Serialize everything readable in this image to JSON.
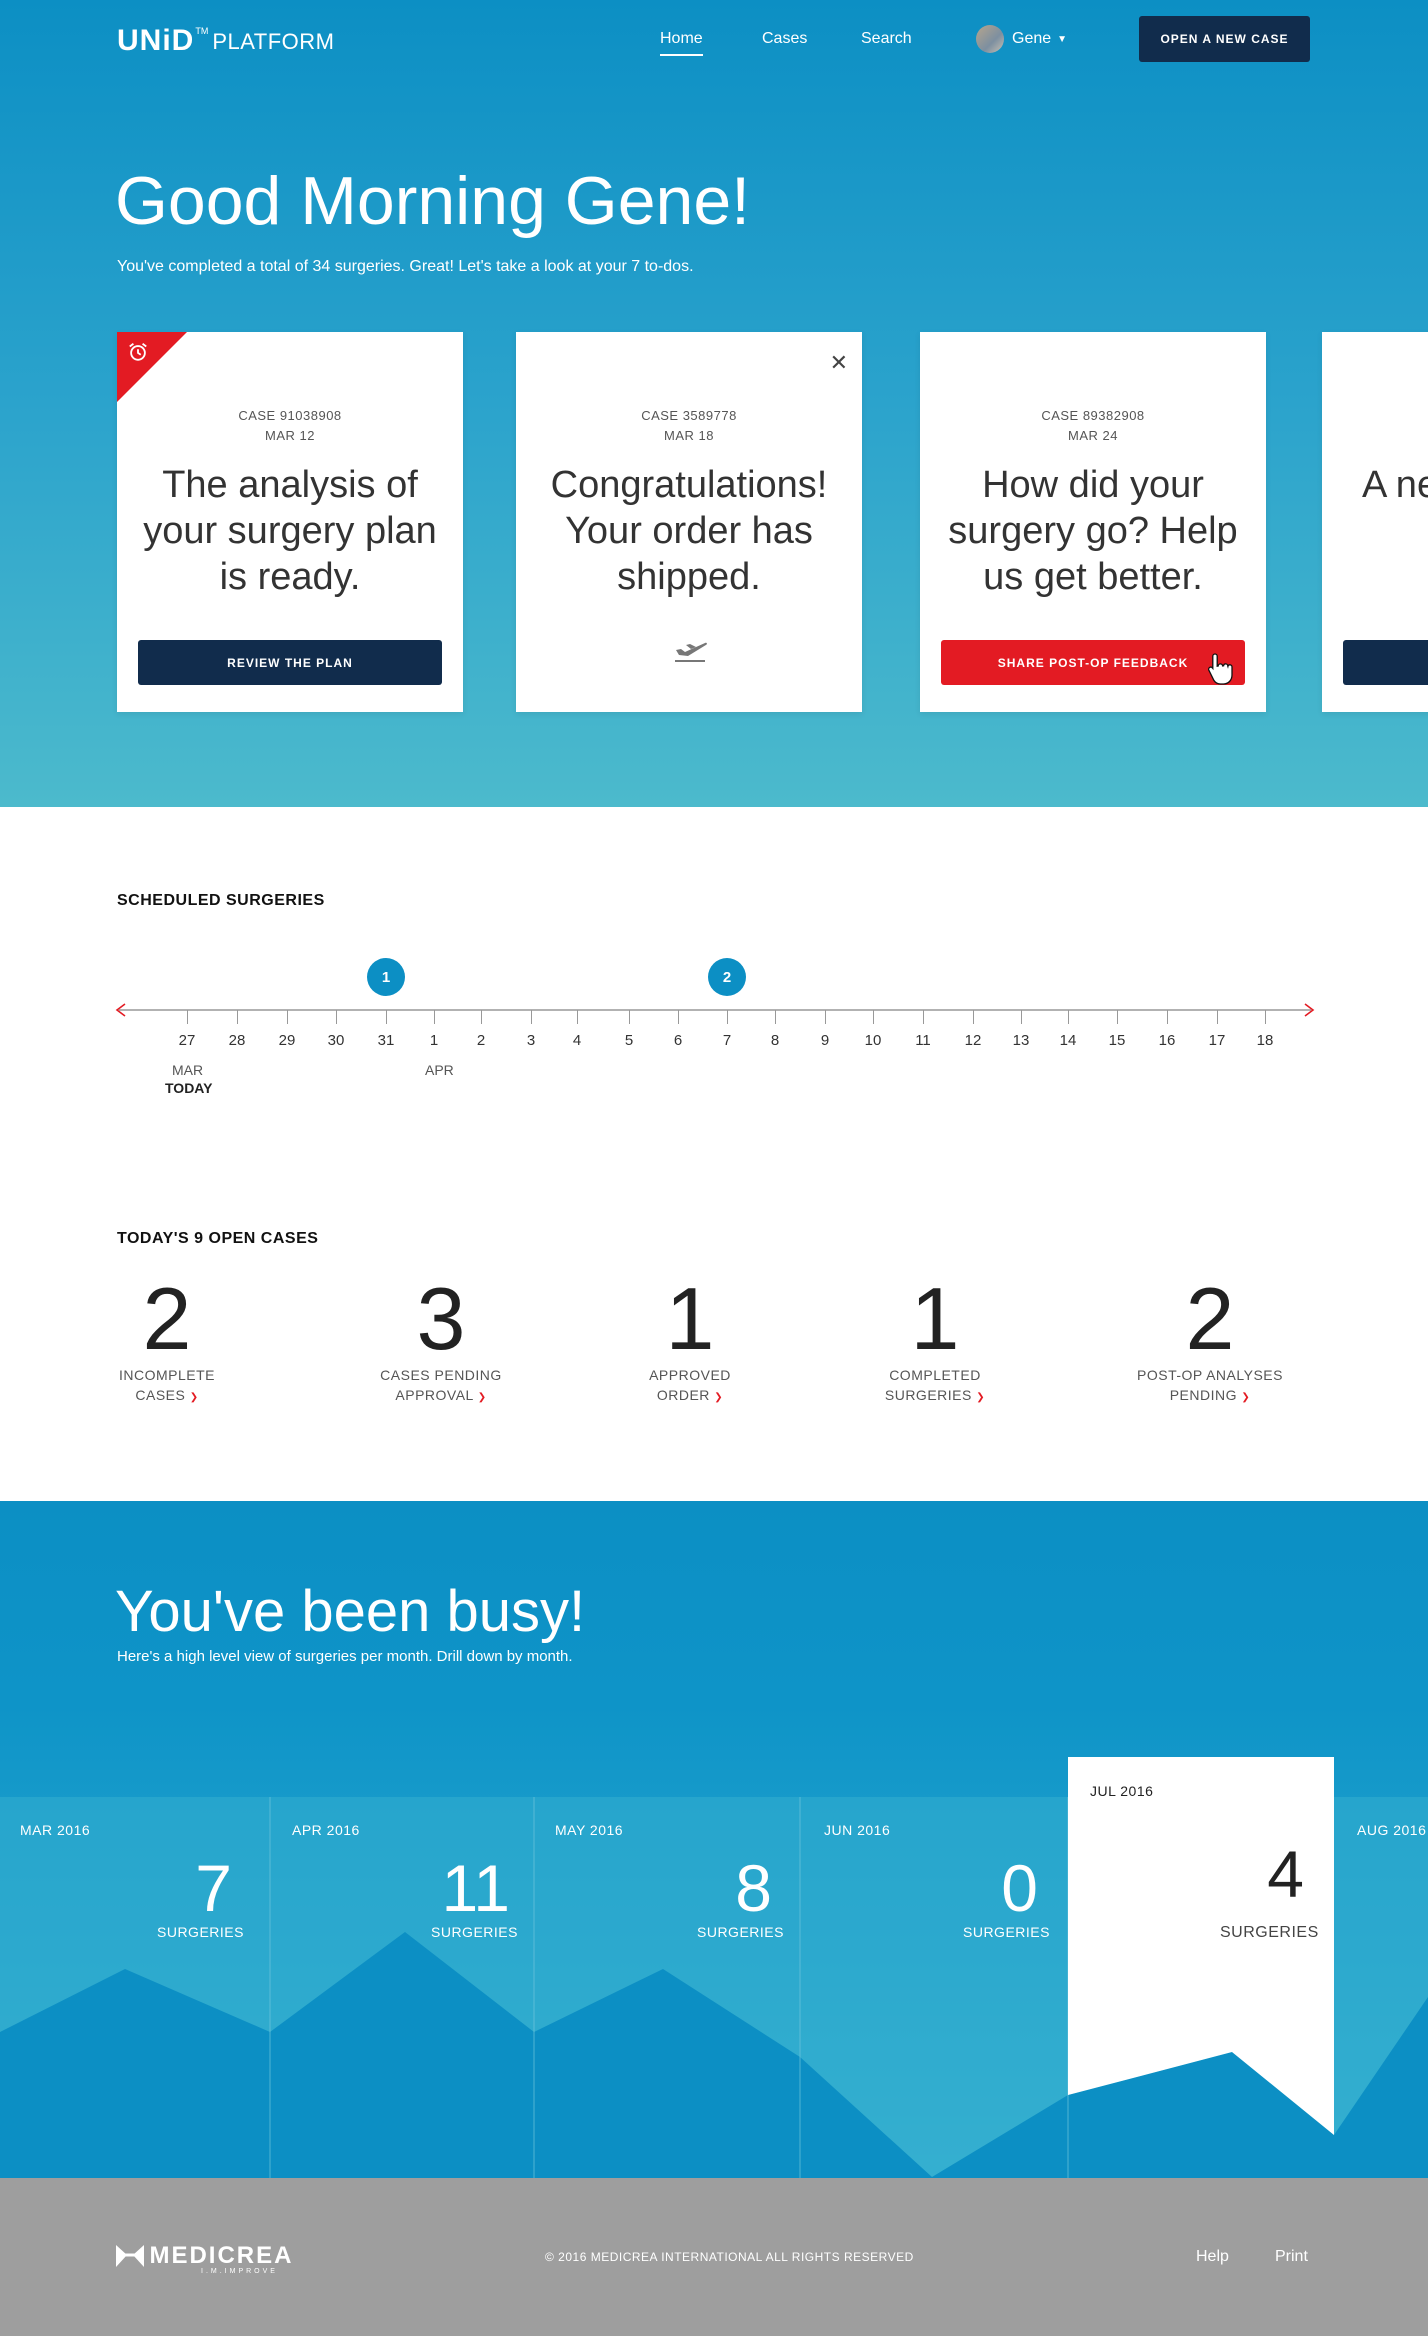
{
  "header": {
    "logo_main": "UNiD",
    "logo_tm": "TM",
    "logo_sub": "PLATFORM",
    "nav": [
      "Home",
      "Cases",
      "Search"
    ],
    "user_name": "Gene",
    "open_case": "OPEN A NEW CASE"
  },
  "hero": {
    "greeting": "Good Morning Gene!",
    "subtitle": "You've completed a total of 34 surgeries. Great! Let's take a look at your 7 to-dos."
  },
  "cards": [
    {
      "case": "CASE 91038908",
      "date": "MAR 12",
      "body": "The analysis of your surgery plan is ready.",
      "button": "REVIEW THE PLAN"
    },
    {
      "case": "CASE 3589778",
      "date": "MAR 18",
      "body": "Congratulations! Your order has shipped."
    },
    {
      "case": "CASE 89382908",
      "date": "MAR 24",
      "body": "How did your surgery go? Help us get better.",
      "button": "SHARE POST-OP FEEDBACK"
    },
    {
      "body": "A ne be v"
    }
  ],
  "scheduled": {
    "title": "SCHEDULED SURGERIES",
    "days": [
      "27",
      "28",
      "29",
      "30",
      "31",
      "1",
      "2",
      "3",
      "4",
      "5",
      "6",
      "7",
      "8",
      "9",
      "10",
      "11",
      "12",
      "13",
      "14",
      "15",
      "16",
      "17",
      "18"
    ],
    "month_labels": [
      "MAR",
      "APR"
    ],
    "today": "TODAY",
    "markers": [
      {
        "day": "31",
        "count": "1"
      },
      {
        "day": "7",
        "count": "2"
      }
    ]
  },
  "open_cases": {
    "title": "TODAY'S 9 OPEN CASES",
    "items": [
      {
        "count": "2",
        "line1": "INCOMPLETE",
        "line2": "CASES"
      },
      {
        "count": "3",
        "line1": "CASES PENDING",
        "line2": "APPROVAL"
      },
      {
        "count": "1",
        "line1": "APPROVED",
        "line2": "ORDER"
      },
      {
        "count": "1",
        "line1": "COMPLETED",
        "line2": "SURGERIES"
      },
      {
        "count": "2",
        "line1": "POST-OP ANALYSES",
        "line2": "PENDING"
      }
    ]
  },
  "busy": {
    "title": "You've been busy!",
    "subtitle": "Here's a high level view of surgeries per month. Drill down by month.",
    "unit": "SURGERIES",
    "months": [
      {
        "label": "MAR 2016",
        "count": "7"
      },
      {
        "label": "APR 2016",
        "count": "11"
      },
      {
        "label": "MAY 2016",
        "count": "8"
      },
      {
        "label": "JUN 2016",
        "count": "0"
      },
      {
        "label": "JUL 2016",
        "count": "4",
        "selected": true
      },
      {
        "label": "AUG 2016"
      }
    ]
  },
  "footer": {
    "brand": "MEDICREA",
    "tagline": "I.M.IMPROVE",
    "copyright": "© 2016 MEDICREA INTERNATIONAL ALL RIGHTS RESERVED",
    "links": [
      "Help",
      "Print"
    ]
  },
  "colors": {
    "primary_blue": "#0c8fc4",
    "navy": "#112c4c",
    "alert_red": "#e31b23",
    "footer_gray": "#9e9e9e"
  }
}
